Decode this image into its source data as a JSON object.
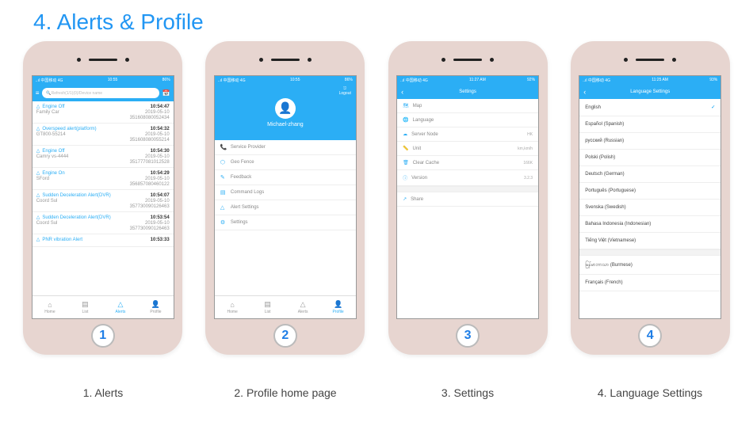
{
  "title": "4. Alerts & Profile",
  "captions": [
    "1. Alerts",
    "2. Profile home page",
    "3. Settings",
    "4. Language Settings"
  ],
  "status": {
    "left": "..ıl 中国移动 4G",
    "time": "10:55",
    "right": "86%",
    "time2": "11:27 AM",
    "time3": "11:25 AM",
    "batt2": "92%",
    "batt3": "93%"
  },
  "alerts": {
    "search_ph": "Refresh(1/1)(0)/Device name",
    "items": [
      {
        "name": "Engine Off",
        "time": "10:54:47",
        "dev": "Family Car",
        "id": "351608080052434",
        "date": "2019-05-10"
      },
      {
        "name": "Overspeed alert(platform)",
        "time": "10:54:32",
        "dev": "GT800-55214",
        "id": "351608080055214",
        "date": "2019-05-10"
      },
      {
        "name": "Engine Off",
        "time": "10:54:30",
        "dev": "Camry vs-4444",
        "id": "351777081012528",
        "date": "2019-05-10"
      },
      {
        "name": "Engine On",
        "time": "10:54:29",
        "dev": "SFord",
        "id": "356857080460122",
        "date": "2019-05-10"
      },
      {
        "name": "Sudden Deceleration Alert(DVR)",
        "time": "10:54:07",
        "dev": "Coord Sul",
        "id": "357730090126463",
        "date": "2019-05-10"
      },
      {
        "name": "Sudden Deceleration Alert(DVR)",
        "time": "10:53:54",
        "dev": "Coord Sul",
        "id": "357730090126463",
        "date": "2019-05-10"
      },
      {
        "name": "PNR vibration Alert",
        "time": "10:53:33",
        "dev": "",
        "id": "",
        "date": ""
      }
    ],
    "tabs": [
      "Home",
      "List",
      "Alerts",
      "Profile"
    ],
    "active_tab": 2
  },
  "profile": {
    "username": "Michael-zhang",
    "logout": "Logout",
    "items": [
      "Service Provider",
      "Geo Fence",
      "Feedback",
      "Command Logs",
      "Alert Settings",
      "Settings"
    ],
    "tabs": [
      "Home",
      "List",
      "Alerts",
      "Profile"
    ],
    "active_tab": 3
  },
  "settings": {
    "title": "Settings",
    "items": [
      {
        "label": "Map",
        "val": ""
      },
      {
        "label": "Language",
        "val": ""
      },
      {
        "label": "Server Node",
        "val": "HK"
      },
      {
        "label": "Unit",
        "val": "km,km/h"
      },
      {
        "label": "Clear Cache",
        "val": "166K"
      },
      {
        "label": "Version",
        "val": "3.2.3"
      },
      {
        "label": "Share",
        "val": ""
      }
    ]
  },
  "lang": {
    "title": "Language Settings",
    "items": [
      "English",
      "Español (Spanish)",
      "русский (Russian)",
      "Polski (Polish)",
      "Deutsch (German)",
      "Português (Portuguese)",
      "Svenska (Swedish)",
      "Bahasa Indonesia (Indonesian)",
      "Tiếng Việt (Vietnamese)",
      "မြန်မာဘာသာ (Burmese)",
      "Français (French)"
    ],
    "selected": 0
  }
}
